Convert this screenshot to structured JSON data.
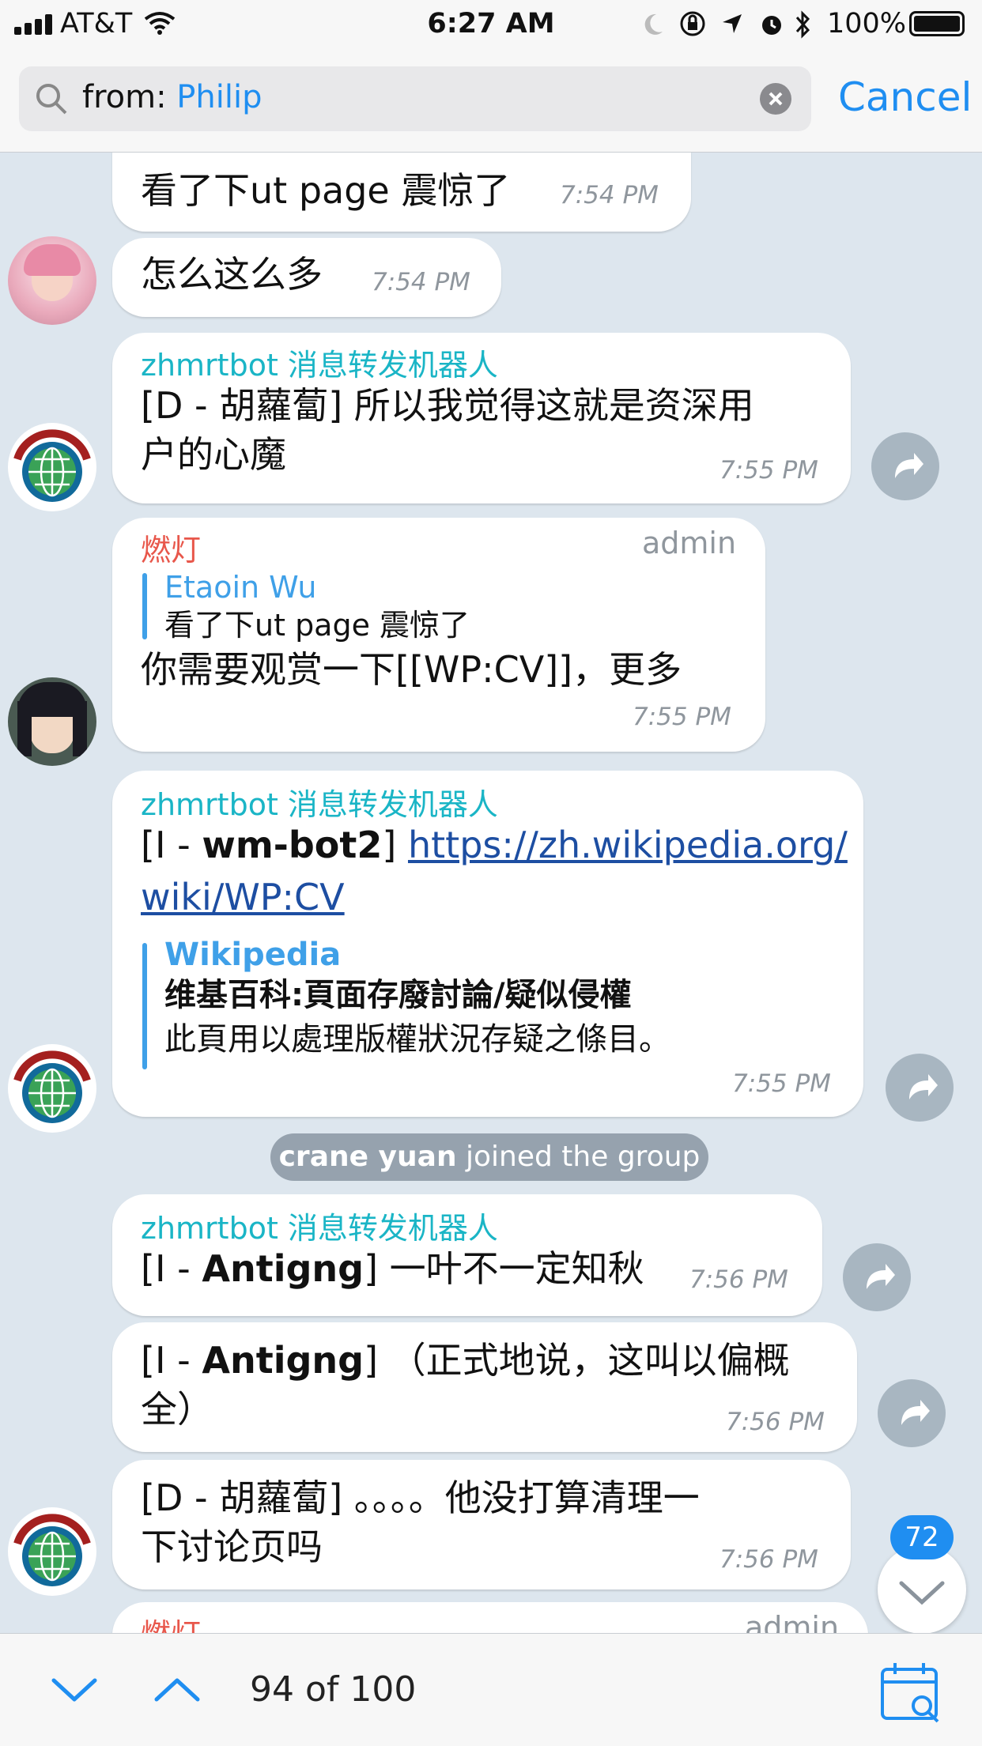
{
  "status_bar": {
    "carrier": "AT&T",
    "time": "6:27 AM",
    "battery": "100%"
  },
  "search": {
    "prefix": "from: ",
    "query": "Philip",
    "cancel_label": "Cancel"
  },
  "messages": [
    {
      "text": "看了下ut page 震惊了",
      "time": "7:54 PM"
    },
    {
      "text": "怎么这么多",
      "time": "7:54 PM"
    },
    {
      "sender": "zhmrtbot 消息转发机器人",
      "line1": "[D - 胡蘿蔔] 所以我觉得这就是资深用",
      "line2": "户的心魔",
      "time": "7:55 PM"
    },
    {
      "sender": "燃灯",
      "role": "admin",
      "quote_sender": "Etaoin Wu",
      "quote_text": "看了下ut page 震惊了",
      "text": "你需要观赏一下[[WP:CV]]，更多",
      "time": "7:55 PM"
    },
    {
      "sender": "zhmrtbot 消息转发机器人",
      "prefix": "[I - ",
      "bold": "wm-bot2",
      "suffix": "] ",
      "link1": "https://zh.wikipedia.org/",
      "link2": "wiki/WP:CV",
      "preview_site": "Wikipedia",
      "preview_title": "维基百科:頁面存廢討論/疑似侵權",
      "preview_desc": "此頁用以處理版權狀況存疑之條目。",
      "time": "7:55 PM"
    },
    {
      "sender": "zhmrtbot 消息转发机器人",
      "prefix": "[I - ",
      "bold": "Antigng",
      "suffix": "] 一叶不一定知秋",
      "time": "7:56 PM"
    },
    {
      "prefix": "[I - ",
      "bold": "Antigng",
      "suffix": "] （正式地说，这叫以偏概",
      "line2": "全）",
      "time": "7:56 PM"
    },
    {
      "line1": "[D - 胡蘿蔔] 。。。。他没打算清理一",
      "line2": "下讨论页吗",
      "time": "7:56 PM"
    },
    {
      "sender": "燃灯",
      "role": "admin"
    }
  ],
  "system_message": {
    "name": "crane yuan",
    "action": " joined the group"
  },
  "scroll_badge": "72",
  "result_counter": "94 of 100",
  "colors": {
    "accent": "#1f8ef1",
    "bot_name": "#1ab5c6",
    "admin_name": "#e8574b"
  }
}
